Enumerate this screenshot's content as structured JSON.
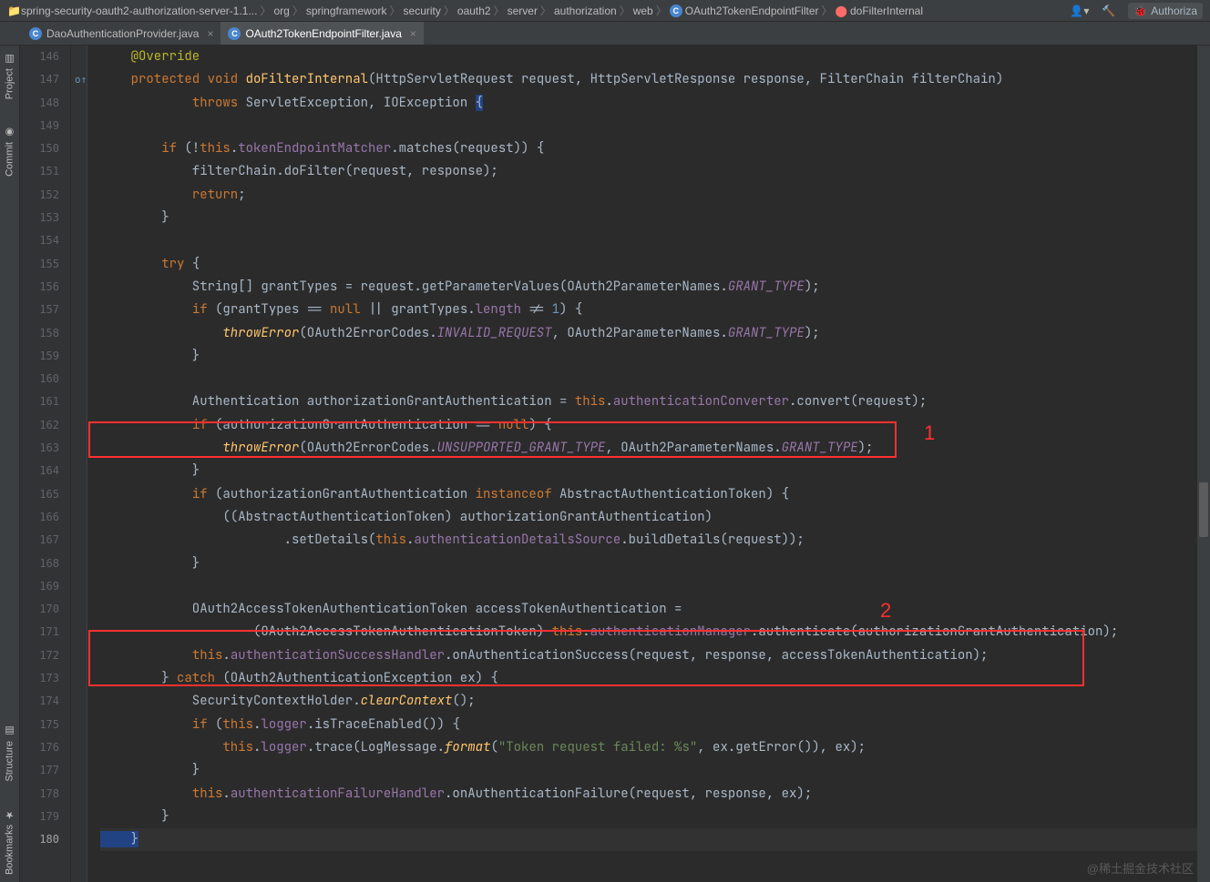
{
  "breadcrumbs": [
    "spring-security-oauth2-authorization-server-1.1...",
    "org",
    "springframework",
    "security",
    "oauth2",
    "server",
    "authorization",
    "web",
    "OAuth2TokenEndpointFilter",
    "doFilterInternal"
  ],
  "run_config_label": "Authoriza",
  "tabs": [
    {
      "label": "DaoAuthenticationProvider.java",
      "active": false
    },
    {
      "label": "OAuth2TokenEndpointFilter.java",
      "active": true
    }
  ],
  "left_tools": {
    "project": "Project",
    "commit": "Commit",
    "structure": "Structure",
    "bookmarks": "Bookmarks"
  },
  "line_start": 146,
  "line_end": 180,
  "current_line": 180,
  "code": {
    "l146": [
      "    ",
      "@Override",
      ""
    ],
    "l147": [
      "    ",
      "protected ",
      "void ",
      "doFilterInternal",
      "(HttpServletRequest request, HttpServletResponse response, FilterChain filterChain)"
    ],
    "l148": [
      "            ",
      "throws ",
      "ServletException, IOException ",
      "{",
      ""
    ],
    "l149": [
      ""
    ],
    "l150": [
      "        ",
      "if ",
      "(!",
      "this",
      ".",
      "tokenEndpointMatcher",
      ".matches(request)) {"
    ],
    "l151": [
      "            filterChain.doFilter(request, response);"
    ],
    "l152": [
      "            ",
      "return",
      ";"
    ],
    "l153": [
      "        }"
    ],
    "l154": [
      ""
    ],
    "l155": [
      "        ",
      "try ",
      "{"
    ],
    "l156": [
      "            String[] grantTypes = request.getParameterValues(OAuth2ParameterNames.",
      "GRANT_TYPE",
      ");"
    ],
    "l157": [
      "            ",
      "if ",
      "(grantTypes == ",
      "null ",
      "|| grantTypes.",
      "length ",
      "!= ",
      "1",
      ") {"
    ],
    "l158": [
      "                ",
      "throwError",
      "(OAuth2ErrorCodes.",
      "INVALID_REQUEST",
      ", OAuth2ParameterNames.",
      "GRANT_TYPE",
      ");"
    ],
    "l159": [
      "            }"
    ],
    "l160": [
      ""
    ],
    "l161": [
      "            Authentication authorizationGrantAuthentication = ",
      "this",
      ".",
      "authenticationConverter",
      ".convert(request);"
    ],
    "l162": [
      "            ",
      "if ",
      "(authorizationGrantAuthentication == ",
      "null",
      ") {"
    ],
    "l163": [
      "                ",
      "throwError",
      "(OAuth2ErrorCodes.",
      "UNSUPPORTED_GRANT_TYPE",
      ", OAuth2ParameterNames.",
      "GRANT_TYPE",
      ");"
    ],
    "l164": [
      "            }"
    ],
    "l165": [
      "            ",
      "if ",
      "(authorizationGrantAuthentication ",
      "instanceof ",
      "AbstractAuthenticationToken) {"
    ],
    "l166": [
      "                ((AbstractAuthenticationToken) authorizationGrantAuthentication)"
    ],
    "l167": [
      "                        .setDetails(",
      "this",
      ".",
      "authenticationDetailsSource",
      ".buildDetails(request));"
    ],
    "l168": [
      "            }"
    ],
    "l169": [
      ""
    ],
    "l170": [
      "            OAuth2AccessTokenAuthenticationToken accessTokenAuthentication ="
    ],
    "l171": [
      "                    (OAuth2AccessTokenAuthenticationToken) ",
      "this",
      ".",
      "authenticationManager",
      ".authenticate(authorizationGrantAuthentication);"
    ],
    "l172": [
      "            ",
      "this",
      ".",
      "authenticationSuccessHandler",
      ".onAuthenticationSuccess(request, response, accessTokenAuthentication);"
    ],
    "l173": [
      "        } ",
      "catch ",
      "(OAuth2AuthenticationException ex) {"
    ],
    "l174": [
      "            SecurityContextHolder.",
      "clearContext",
      "();"
    ],
    "l175": [
      "            ",
      "if ",
      "(",
      "this",
      ".",
      "logger",
      ".isTraceEnabled()) {"
    ],
    "l176": [
      "                ",
      "this",
      ".",
      "logger",
      ".trace(LogMessage.",
      "format",
      "(",
      "\"Token request failed: %s\"",
      ", ex.getError()), ex);"
    ],
    "l177": [
      "            }"
    ],
    "l178": [
      "            ",
      "this",
      ".",
      "authenticationFailureHandler",
      ".onAuthenticationFailure(request, response, ex);"
    ],
    "l179": [
      "        }"
    ],
    "l180": [
      "    }",
      ""
    ]
  },
  "code_classes": {
    "l146": [
      "",
      "ann",
      ""
    ],
    "l147": [
      "",
      "kw",
      "kw",
      "fn",
      ""
    ],
    "l148": [
      "",
      "kw",
      "",
      "str-bg",
      ""
    ],
    "l149": [
      ""
    ],
    "l150": [
      "",
      "kw",
      "",
      "kw",
      "",
      "field",
      ""
    ],
    "l151": [
      ""
    ],
    "l152": [
      "",
      "kw",
      ""
    ],
    "l153": [
      ""
    ],
    "l154": [
      ""
    ],
    "l155": [
      "",
      "kw",
      ""
    ],
    "l156": [
      "",
      "const",
      ""
    ],
    "l157": [
      "",
      "kw",
      "",
      "kw",
      "",
      "field",
      "",
      "num",
      ""
    ],
    "l158": [
      "",
      "fn-it",
      "",
      "const",
      "",
      "const",
      ""
    ],
    "l159": [
      ""
    ],
    "l160": [
      ""
    ],
    "l161": [
      "",
      "kw",
      "",
      "field",
      ""
    ],
    "l162": [
      "",
      "kw",
      "",
      "kw",
      ""
    ],
    "l163": [
      "",
      "fn-it",
      "",
      "const",
      "",
      "const",
      ""
    ],
    "l164": [
      ""
    ],
    "l165": [
      "",
      "kw",
      "",
      "kw",
      ""
    ],
    "l166": [
      ""
    ],
    "l167": [
      "",
      "kw",
      "",
      "field",
      ""
    ],
    "l168": [
      ""
    ],
    "l169": [
      ""
    ],
    "l170": [
      ""
    ],
    "l171": [
      "",
      "kw",
      "",
      "field",
      ""
    ],
    "l172": [
      "",
      "kw",
      "",
      "field",
      ""
    ],
    "l173": [
      "",
      "kw",
      ""
    ],
    "l174": [
      "",
      "fn-it",
      ""
    ],
    "l175": [
      "",
      "kw",
      "",
      "kw",
      "",
      "field",
      ""
    ],
    "l176": [
      "",
      "kw",
      "",
      "field",
      "",
      "fn-it",
      "",
      "str",
      ""
    ],
    "l177": [
      ""
    ],
    "l178": [
      "",
      "kw",
      "",
      "field",
      ""
    ],
    "l179": [
      ""
    ],
    "l180": [
      "hl",
      ""
    ]
  },
  "annotations": {
    "label1": "1",
    "label2": "2"
  },
  "watermark": "@稀土掘金技术社区"
}
